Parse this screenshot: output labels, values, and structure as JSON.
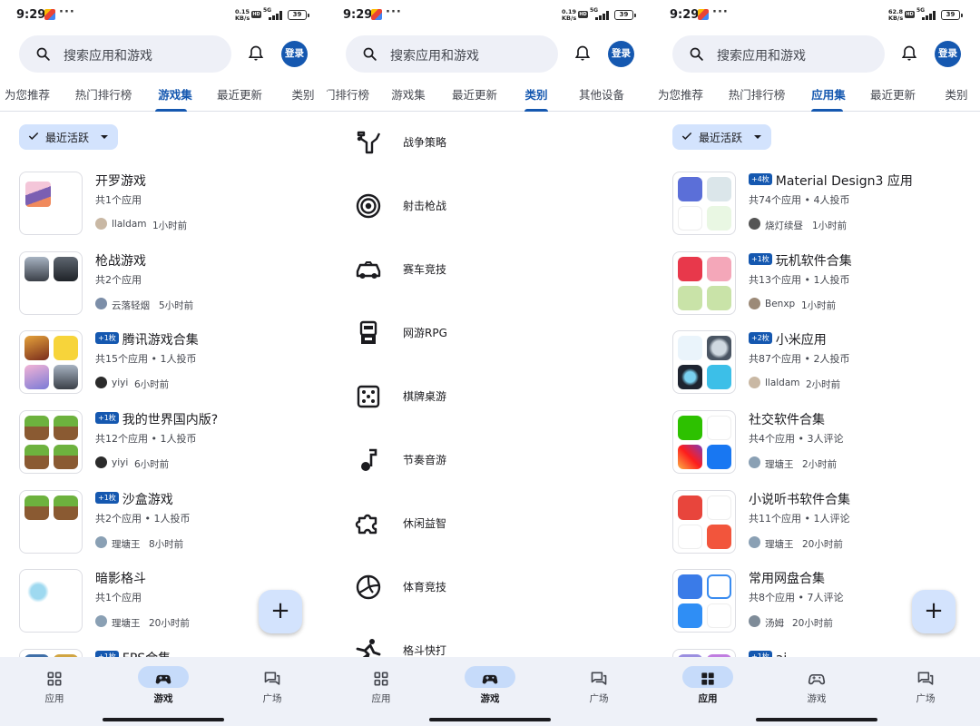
{
  "status_bar": {
    "time": "9:29",
    "dots": "···",
    "speeds": [
      "0.15\nKB/s",
      "0.19\nKB/s",
      "62.8\nKB/s"
    ],
    "hd": "HD",
    "net": "5G",
    "battery": "39"
  },
  "search": {
    "placeholder": "搜索应用和游戏"
  },
  "login_label": "登录",
  "chip": {
    "label": "最近活跃"
  },
  "panel1": {
    "tabs": [
      "为您推荐",
      "热门排行榜",
      "游戏集",
      "最近更新",
      "类别"
    ],
    "active_tab": "游戏集",
    "items": [
      {
        "title": "开罗游戏",
        "badge": "",
        "sub": "共1个应用",
        "user": "llaldam",
        "time": "1小时前",
        "avatar_color": "#c9b8a4"
      },
      {
        "title": "枪战游戏",
        "badge": "",
        "sub": "共2个应用",
        "user": "云落轻烟",
        "time": "5小时前",
        "avatar_color": "#7c8ea8"
      },
      {
        "title": "腾讯游戏合集",
        "badge": "+1枚",
        "sub": "共15个应用 • 1人投币",
        "user": "yiyi",
        "time": "6小时前",
        "avatar_color": "#2b2b2b"
      },
      {
        "title": "我的世界国内版?",
        "badge": "+1枚",
        "sub": "共12个应用 • 1人投币",
        "user": "yiyi",
        "time": "6小时前",
        "avatar_color": "#2b2b2b"
      },
      {
        "title": "沙盒游戏",
        "badge": "+1枚",
        "sub": "共2个应用 • 1人投币",
        "user": "理塘王",
        "time": "8小时前",
        "avatar_color": "#8aa0b4"
      },
      {
        "title": "暗影格斗",
        "badge": "",
        "sub": "共1个应用",
        "user": "理塘王",
        "time": "20小时前",
        "avatar_color": "#8aa0b4"
      },
      {
        "title": "FPS合集",
        "badge": "+1枚",
        "sub": "",
        "user": "",
        "time": "",
        "avatar_color": "#8aa0b4"
      }
    ]
  },
  "panel2": {
    "tabs": [
      "门排行榜",
      "游戏集",
      "最近更新",
      "类别",
      "其他设备"
    ],
    "active_tab": "类别",
    "categories": [
      {
        "label": "战争策略",
        "icon": "strategy-icon"
      },
      {
        "label": "射击枪战",
        "icon": "target-icon"
      },
      {
        "label": "赛车竞技",
        "icon": "racing-car-icon"
      },
      {
        "label": "网游RPG",
        "icon": "rpg-icon"
      },
      {
        "label": "棋牌桌游",
        "icon": "dice-icon"
      },
      {
        "label": "节奏音游",
        "icon": "music-note-icon"
      },
      {
        "label": "休闲益智",
        "icon": "puzzle-icon"
      },
      {
        "label": "体育竞技",
        "icon": "volleyball-icon"
      },
      {
        "label": "格斗快打",
        "icon": "martial-arts-icon"
      }
    ]
  },
  "panel3": {
    "tabs": [
      "为您推荐",
      "热门排行榜",
      "应用集",
      "最近更新",
      "类别"
    ],
    "active_tab": "应用集",
    "items": [
      {
        "title": "Material Design3 应用",
        "badge": "+4枚",
        "sub": "共74个应用 • 4人投币",
        "user": "烧灯续昼",
        "time": "1小时前",
        "avatar_color": "#555555"
      },
      {
        "title": "玩机软件合集",
        "badge": "+1枚",
        "sub": "共13个应用 • 1人投币",
        "user": "Benxp",
        "time": "1小时前",
        "avatar_color": "#9c8a78"
      },
      {
        "title": "小米应用",
        "badge": "+2枚",
        "sub": "共87个应用 • 2人投币",
        "user": "llaldam",
        "time": "2小时前",
        "avatar_color": "#c9b8a4"
      },
      {
        "title": "社交软件合集",
        "badge": "",
        "sub": "共4个应用 • 3人评论",
        "user": "理塘王",
        "time": "2小时前",
        "avatar_color": "#8aa0b4"
      },
      {
        "title": "小说听书软件合集",
        "badge": "",
        "sub": "共11个应用 • 1人评论",
        "user": "理塘王",
        "time": "20小时前",
        "avatar_color": "#8aa0b4"
      },
      {
        "title": "常用网盘合集",
        "badge": "",
        "sub": "共8个应用 • 7人评论",
        "user": "汤姆",
        "time": "20小时前",
        "avatar_color": "#7f8c99"
      },
      {
        "title": "ai",
        "badge": "+1枚",
        "sub": "",
        "user": "",
        "time": "",
        "avatar_color": "#8aa0b4"
      }
    ]
  },
  "nav": [
    {
      "label": "应用",
      "icon": "apps-grid-icon"
    },
    {
      "label": "游戏",
      "icon": "gamepad-icon"
    },
    {
      "label": "广场",
      "icon": "forum-icon"
    }
  ],
  "fab_label": "+",
  "colors": {
    "accent": "#1558b0",
    "chip_bg": "#d3e3fd",
    "nav_bg": "#eef1f8",
    "search_bg": "#eef0f7"
  }
}
